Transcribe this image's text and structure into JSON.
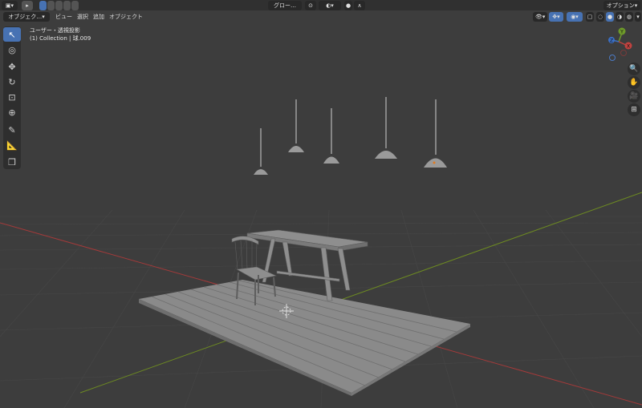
{
  "header": {
    "mode_select": "オブジェク…",
    "menus": [
      "ビュー",
      "選択",
      "追加",
      "オブジェクト"
    ],
    "transform_orientation": "グロー…",
    "options_label": "オプション"
  },
  "viewport_info": {
    "view_name": "ユーザー・透視投影",
    "collection_line": "(1) Collection | 球.009"
  },
  "gizmo": {
    "axis_y": "Y",
    "axis_x": "X",
    "axis_z": "Z"
  },
  "toolbar": {
    "tools": [
      "select-box-icon",
      "cursor-icon",
      "move-icon",
      "rotate-icon",
      "scale-icon",
      "transform-icon",
      "annotate-icon",
      "measure-icon",
      "add-cube-icon"
    ]
  },
  "nav": {
    "buttons": [
      "zoom-icon",
      "hand-pan-icon",
      "camera-icon",
      "grid-view-icon"
    ]
  },
  "colors": {
    "accent": "#4772b3",
    "viewport_bg": "#3d3d3d",
    "x_axis": "#c0423f",
    "y_axis": "#7a9a2a",
    "model_gray": "#8e8e8e"
  }
}
